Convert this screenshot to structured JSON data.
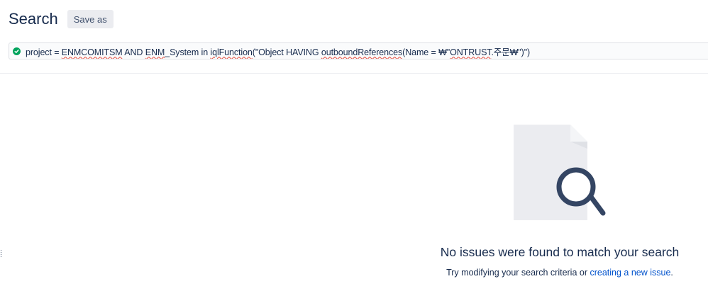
{
  "header": {
    "title": "Search",
    "save_as_label": "Save as"
  },
  "query": {
    "status_icon": "check-circle-icon",
    "status_color": "#00a35c",
    "parts": {
      "p1": "project = ",
      "p2": "ENMCOMITSM",
      "p3": " AND ",
      "p4": "ENM",
      "p5": "_System in ",
      "p6": "iqlFunction",
      "p7": "(\"Object HAVING ",
      "p8": "outboundReferences",
      "p9": "(Name = ₩\"",
      "p10": "ONTRUST",
      "p11": ".주문₩\")\")"
    }
  },
  "empty_state": {
    "icon": "document-search-icon",
    "title": "No issues were found to match your search",
    "subtitle_prefix": "Try modifying your search criteria or ",
    "link_text": "creating a new issue",
    "subtitle_suffix": "."
  },
  "colors": {
    "link": "#0052cc",
    "text": "#172b4d",
    "error_underline": "#e5493a"
  }
}
